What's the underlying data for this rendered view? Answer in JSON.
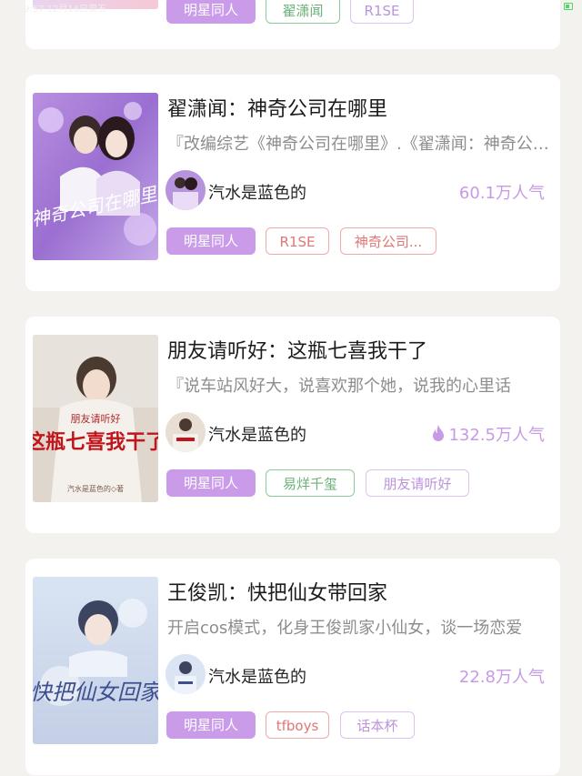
{
  "status_bar": {
    "time": "上午9:57 12月16日周五"
  },
  "books": [
    {
      "tags": [
        {
          "label": "明星同人",
          "style": "purple"
        },
        {
          "label": "翟潇闻",
          "style": "green"
        },
        {
          "label": "R1SE",
          "style": "lilac"
        }
      ]
    },
    {
      "title": "翟潇闻：神奇公司在哪里",
      "description": "『改编综艺《神奇公司在哪里》.《翟潇闻：神奇公司在哪里》",
      "cover_text": "神奇公司在哪里",
      "author": "汽水是蓝色的",
      "popularity": "60.1万人气",
      "hot": false,
      "tags": [
        {
          "label": "明星同人",
          "style": "purple"
        },
        {
          "label": "R1SE",
          "style": "red"
        },
        {
          "label": "神奇公司...",
          "style": "red"
        }
      ]
    },
    {
      "title": "朋友请听好：这瓶七喜我干了",
      "description": "『说车站风好大，说喜欢那个她，说我的心里话",
      "cover_text": "这瓶七喜我干了",
      "cover_subtitle": "朋友请听好",
      "cover_author": "汽水是蓝色的◇著",
      "author": "汽水是蓝色的",
      "popularity": "132.5万人气",
      "hot": true,
      "tags": [
        {
          "label": "明星同人",
          "style": "purple"
        },
        {
          "label": "易烊千玺",
          "style": "green"
        },
        {
          "label": "朋友请听好",
          "style": "lilac"
        }
      ]
    },
    {
      "title": "王俊凯：快把仙女带回家",
      "description": "开启cos模式，化身王俊凯家小仙女，谈一场恋爱",
      "cover_text": "快把仙女回家",
      "author": "汽水是蓝色的",
      "popularity": "22.8万人气",
      "hot": false,
      "tags": [
        {
          "label": "明星同人",
          "style": "purple"
        },
        {
          "label": "tfboys",
          "style": "red"
        },
        {
          "label": "话本杯",
          "style": "lilac"
        }
      ]
    }
  ],
  "colors": {
    "accent_purple": "#c99be9",
    "popularity_purple": "#c79ae6",
    "hot_flame": "#c79ae6"
  },
  "icons": {
    "hot": "flame-icon",
    "battery": "battery-icon"
  }
}
